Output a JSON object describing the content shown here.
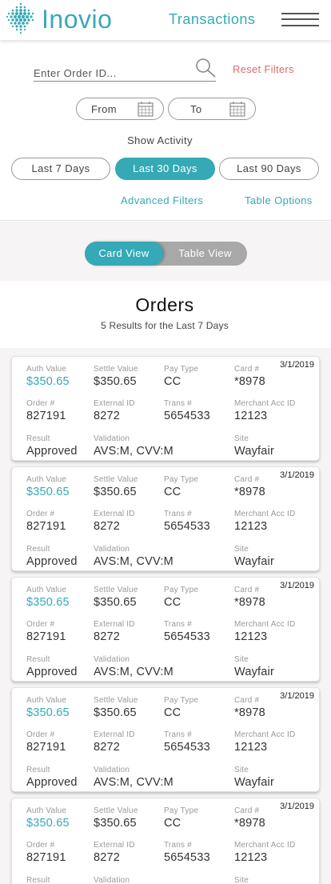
{
  "header": {
    "logo_text": "Inovio",
    "title": "Transactions",
    "menu_icon": "hamburger-menu-icon",
    "brand_color": "#35a9b5"
  },
  "filters": {
    "order_placeholder": "Enter Order ID...",
    "search_icon": "search-icon",
    "reset_label": "Reset Filters",
    "reset_color": "#e06a6a",
    "from_label": "From",
    "to_label": "To",
    "calendar_icon": "calendar-icon",
    "show_activity_label": "Show Activity",
    "activity_options": [
      "Last 7 Days",
      "Last 30 Days",
      "Last 90 Days"
    ],
    "activity_selected": "Last 30 Days",
    "advanced_label": "Advanced Filters",
    "table_options_label": "Table Options"
  },
  "view_toggle": {
    "card_label": "Card View",
    "table_label": "Table View",
    "selected": "Card View"
  },
  "orders": {
    "title": "Orders",
    "subtitle": "5 Results for the Last 7 Days",
    "field_labels": {
      "auth_value": "Auth Value",
      "settle_value": "Settle Value",
      "pay_type": "Pay Type",
      "card": "Card #",
      "order": "Order #",
      "external_id": "External ID",
      "trans": "Trans #",
      "merchant": "Merchant Acc ID",
      "result": "Result",
      "validation": "Validation",
      "site": "Site"
    },
    "cards": [
      {
        "date": "3/1/2019",
        "auth_value": "$350.65",
        "settle_value": "$350.65",
        "pay_type": "CC",
        "card": "*8978",
        "order": "827191",
        "external_id": "8272",
        "trans": "5654533",
        "merchant": "12123",
        "result": "Approved",
        "validation": "AVS:M, CVV:M",
        "site": "Wayfair"
      },
      {
        "date": "3/1/2019",
        "auth_value": "$350.65",
        "settle_value": "$350.65",
        "pay_type": "CC",
        "card": "*8978",
        "order": "827191",
        "external_id": "8272",
        "trans": "5654533",
        "merchant": "12123",
        "result": "Approved",
        "validation": "AVS:M, CVV:M",
        "site": "Wayfair"
      },
      {
        "date": "3/1/2019",
        "auth_value": "$350.65",
        "settle_value": "$350.65",
        "pay_type": "CC",
        "card": "*8978",
        "order": "827191",
        "external_id": "8272",
        "trans": "5654533",
        "merchant": "12123",
        "result": "Approved",
        "validation": "AVS:M, CVV:M",
        "site": "Wayfair"
      },
      {
        "date": "3/1/2019",
        "auth_value": "$350.65",
        "settle_value": "$350.65",
        "pay_type": "CC",
        "card": "*8978",
        "order": "827191",
        "external_id": "8272",
        "trans": "5654533",
        "merchant": "12123",
        "result": "Approved",
        "validation": "AVS:M, CVV:M",
        "site": "Wayfair"
      },
      {
        "date": "3/1/2019",
        "auth_value": "$350.65",
        "settle_value": "$350.65",
        "pay_type": "CC",
        "card": "*8978",
        "order": "827191",
        "external_id": "8272",
        "trans": "5654533",
        "merchant": "12123",
        "result": "",
        "validation": "",
        "site": ""
      }
    ]
  }
}
